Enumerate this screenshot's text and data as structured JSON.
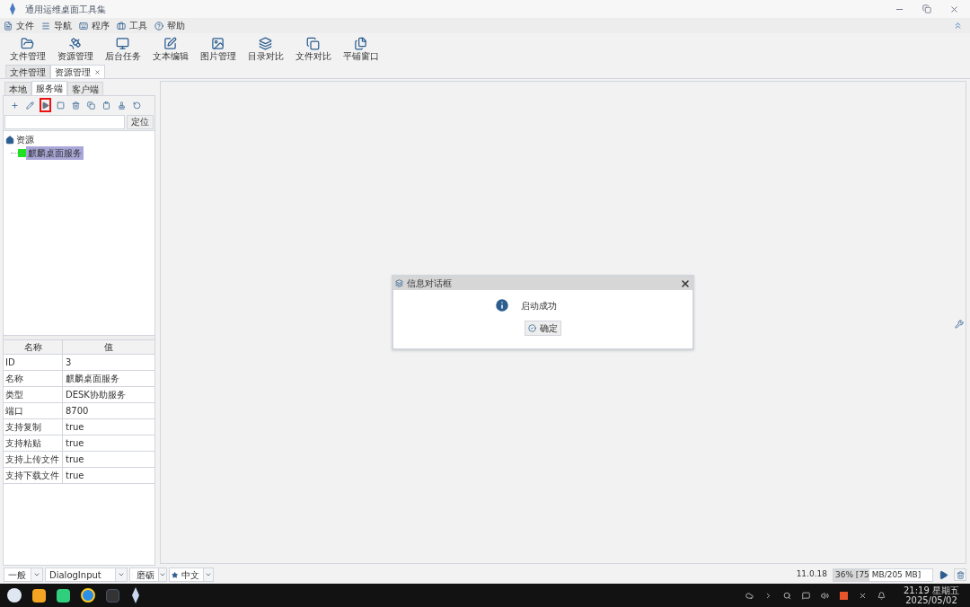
{
  "window": {
    "title": "通用运维桌面工具集"
  },
  "menu": [
    {
      "label": "文件"
    },
    {
      "label": "导航"
    },
    {
      "label": "程序"
    },
    {
      "label": "工具"
    },
    {
      "label": "帮助"
    }
  ],
  "toolbar": [
    {
      "label": "文件管理"
    },
    {
      "label": "资源管理"
    },
    {
      "label": "后台任务"
    },
    {
      "label": "文本编辑"
    },
    {
      "label": "图片管理"
    },
    {
      "label": "目录对比"
    },
    {
      "label": "文件对比"
    },
    {
      "label": "平铺窗口"
    }
  ],
  "doc_tabs": [
    {
      "label": "文件管理",
      "selected": false,
      "closable": false
    },
    {
      "label": "资源管理",
      "selected": true,
      "closable": true
    }
  ],
  "side_tabs": [
    {
      "label": "本地",
      "selected": false
    },
    {
      "label": "服务端",
      "selected": true
    },
    {
      "label": "客户端",
      "selected": false
    }
  ],
  "side_tools": [
    {
      "highlighted": false
    },
    {
      "highlighted": false
    },
    {
      "highlighted": true
    },
    {
      "highlighted": false
    },
    {
      "highlighted": false
    },
    {
      "highlighted": false
    },
    {
      "highlighted": false
    },
    {
      "highlighted": false
    },
    {
      "highlighted": false
    }
  ],
  "locate_button": "定位",
  "tree": {
    "label": "资源",
    "children": [
      {
        "label": "麒麟桌面服务",
        "selected": true
      }
    ]
  },
  "properties": {
    "columns": [
      "名称",
      "值"
    ],
    "rows": [
      {
        "name": "ID",
        "value": "3"
      },
      {
        "name": "名称",
        "value": "麒麟桌面服务"
      },
      {
        "name": "类型",
        "value": "DESK协助服务"
      },
      {
        "name": "端口",
        "value": "8700"
      },
      {
        "name": "支持复制",
        "value": "true"
      },
      {
        "name": "支持粘贴",
        "value": "true"
      },
      {
        "name": "支持上传文件",
        "value": "true"
      },
      {
        "name": "支持下载文件",
        "value": "true"
      }
    ]
  },
  "dialog": {
    "title": "信息对话框",
    "message": "启动成功",
    "button": "确定"
  },
  "bottom_bar": {
    "font_style": "一般",
    "font": "DialogInput",
    "render": "磨砺",
    "language": "中文",
    "version": "11.0.18",
    "memory": {
      "reading": "36% [75 MB/205 MB]",
      "level": 0.36
    }
  },
  "taskbar": {
    "time": "21:19 星期五",
    "date": "2025/05/02"
  }
}
